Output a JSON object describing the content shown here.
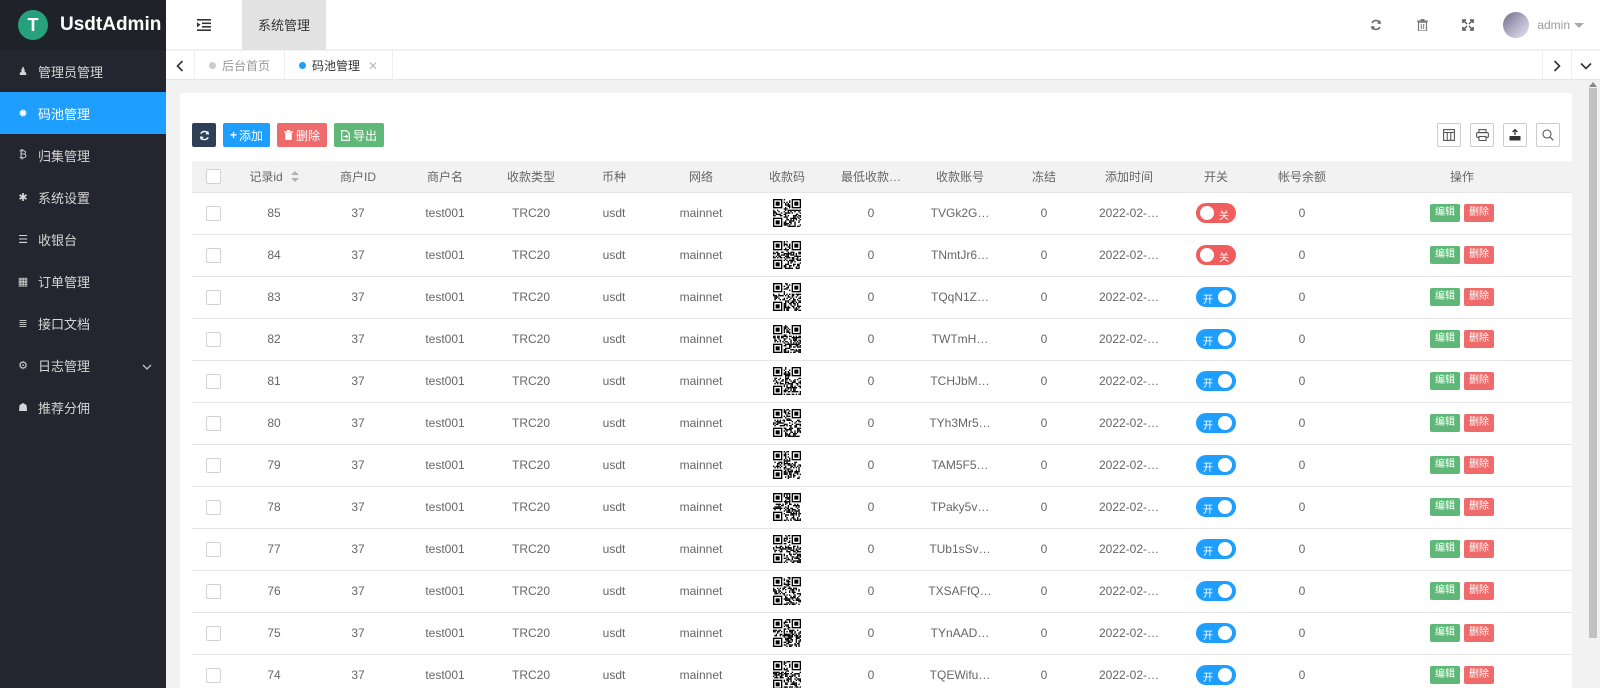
{
  "app": {
    "title": "UsdtAdmin",
    "logo_glyph": "T"
  },
  "sidebar": {
    "items": [
      {
        "label": "管理员管理",
        "icon": "user-icon",
        "glyph": "♟",
        "active": false
      },
      {
        "label": "码池管理",
        "icon": "gear-icon",
        "glyph": "✹",
        "active": true
      },
      {
        "label": "归集管理",
        "icon": "bitcoin-icon",
        "glyph": "₿",
        "active": false
      },
      {
        "label": "系统设置",
        "icon": "asterisk-icon",
        "glyph": "✱",
        "active": false
      },
      {
        "label": "收银台",
        "icon": "list-icon",
        "glyph": "☰",
        "active": false
      },
      {
        "label": "订单管理",
        "icon": "calculator-icon",
        "glyph": "▦",
        "active": false
      },
      {
        "label": "接口文档",
        "icon": "align-left-icon",
        "glyph": "≣",
        "active": false
      },
      {
        "label": "日志管理",
        "icon": "cog-icon",
        "glyph": "⚙",
        "active": false,
        "has_children": true
      },
      {
        "label": "推荐分佣",
        "icon": "android-icon",
        "glyph": "☗",
        "active": false
      }
    ]
  },
  "header": {
    "tab_label": "系统管理",
    "user_name": "admin"
  },
  "tabbar": {
    "tabs": [
      {
        "label": "后台首页",
        "active": false,
        "closable": false
      },
      {
        "label": "码池管理",
        "active": true,
        "closable": true
      }
    ],
    "close_glyph": "✕"
  },
  "toolbar": {
    "add_label": "添加",
    "delete_label": "删除",
    "export_label": "导出"
  },
  "table": {
    "columns": [
      "记录id",
      "商户ID",
      "商户名",
      "收款类型",
      "币种",
      "网络",
      "收款码",
      "最低收款…",
      "收款账号",
      "冻结",
      "添加时间",
      "开关",
      "帐号余额",
      "操作"
    ],
    "switch_on_label": "开",
    "switch_off_label": "关",
    "edit_label": "编辑",
    "delete_label": "删除",
    "rows": [
      {
        "id": "85",
        "merchant_id": "37",
        "merchant_name": "test001",
        "type": "TRC20",
        "currency": "usdt",
        "network": "mainnet",
        "min": "0",
        "account": "TVGk2G…",
        "frozen": "0",
        "time": "2022-02-…",
        "enabled": false,
        "balance": "0"
      },
      {
        "id": "84",
        "merchant_id": "37",
        "merchant_name": "test001",
        "type": "TRC20",
        "currency": "usdt",
        "network": "mainnet",
        "min": "0",
        "account": "TNmtJr6…",
        "frozen": "0",
        "time": "2022-02-…",
        "enabled": false,
        "balance": "0"
      },
      {
        "id": "83",
        "merchant_id": "37",
        "merchant_name": "test001",
        "type": "TRC20",
        "currency": "usdt",
        "network": "mainnet",
        "min": "0",
        "account": "TQqN1Z…",
        "frozen": "0",
        "time": "2022-02-…",
        "enabled": true,
        "balance": "0"
      },
      {
        "id": "82",
        "merchant_id": "37",
        "merchant_name": "test001",
        "type": "TRC20",
        "currency": "usdt",
        "network": "mainnet",
        "min": "0",
        "account": "TWTmH…",
        "frozen": "0",
        "time": "2022-02-…",
        "enabled": true,
        "balance": "0"
      },
      {
        "id": "81",
        "merchant_id": "37",
        "merchant_name": "test001",
        "type": "TRC20",
        "currency": "usdt",
        "network": "mainnet",
        "min": "0",
        "account": "TCHJbM…",
        "frozen": "0",
        "time": "2022-02-…",
        "enabled": true,
        "balance": "0"
      },
      {
        "id": "80",
        "merchant_id": "37",
        "merchant_name": "test001",
        "type": "TRC20",
        "currency": "usdt",
        "network": "mainnet",
        "min": "0",
        "account": "TYh3Mr5…",
        "frozen": "0",
        "time": "2022-02-…",
        "enabled": true,
        "balance": "0"
      },
      {
        "id": "79",
        "merchant_id": "37",
        "merchant_name": "test001",
        "type": "TRC20",
        "currency": "usdt",
        "network": "mainnet",
        "min": "0",
        "account": "TAM5F5…",
        "frozen": "0",
        "time": "2022-02-…",
        "enabled": true,
        "balance": "0"
      },
      {
        "id": "78",
        "merchant_id": "37",
        "merchant_name": "test001",
        "type": "TRC20",
        "currency": "usdt",
        "network": "mainnet",
        "min": "0",
        "account": "TPaky5v…",
        "frozen": "0",
        "time": "2022-02-…",
        "enabled": true,
        "balance": "0"
      },
      {
        "id": "77",
        "merchant_id": "37",
        "merchant_name": "test001",
        "type": "TRC20",
        "currency": "usdt",
        "network": "mainnet",
        "min": "0",
        "account": "TUb1sSv…",
        "frozen": "0",
        "time": "2022-02-…",
        "enabled": true,
        "balance": "0"
      },
      {
        "id": "76",
        "merchant_id": "37",
        "merchant_name": "test001",
        "type": "TRC20",
        "currency": "usdt",
        "network": "mainnet",
        "min": "0",
        "account": "TXSAFfQ…",
        "frozen": "0",
        "time": "2022-02-…",
        "enabled": true,
        "balance": "0"
      },
      {
        "id": "75",
        "merchant_id": "37",
        "merchant_name": "test001",
        "type": "TRC20",
        "currency": "usdt",
        "network": "mainnet",
        "min": "0",
        "account": "TYnAAD…",
        "frozen": "0",
        "time": "2022-02-…",
        "enabled": true,
        "balance": "0"
      },
      {
        "id": "74",
        "merchant_id": "37",
        "merchant_name": "test001",
        "type": "TRC20",
        "currency": "usdt",
        "network": "mainnet",
        "min": "0",
        "account": "TQEWifu…",
        "frozen": "0",
        "time": "2022-02-…",
        "enabled": true,
        "balance": "0"
      }
    ]
  },
  "colors": {
    "sidebar_bg": "#23262e",
    "active_blue": "#1e9fff",
    "danger_red": "#ef6b6b",
    "success_green": "#5fb878",
    "dark_btn": "#2f4056"
  }
}
